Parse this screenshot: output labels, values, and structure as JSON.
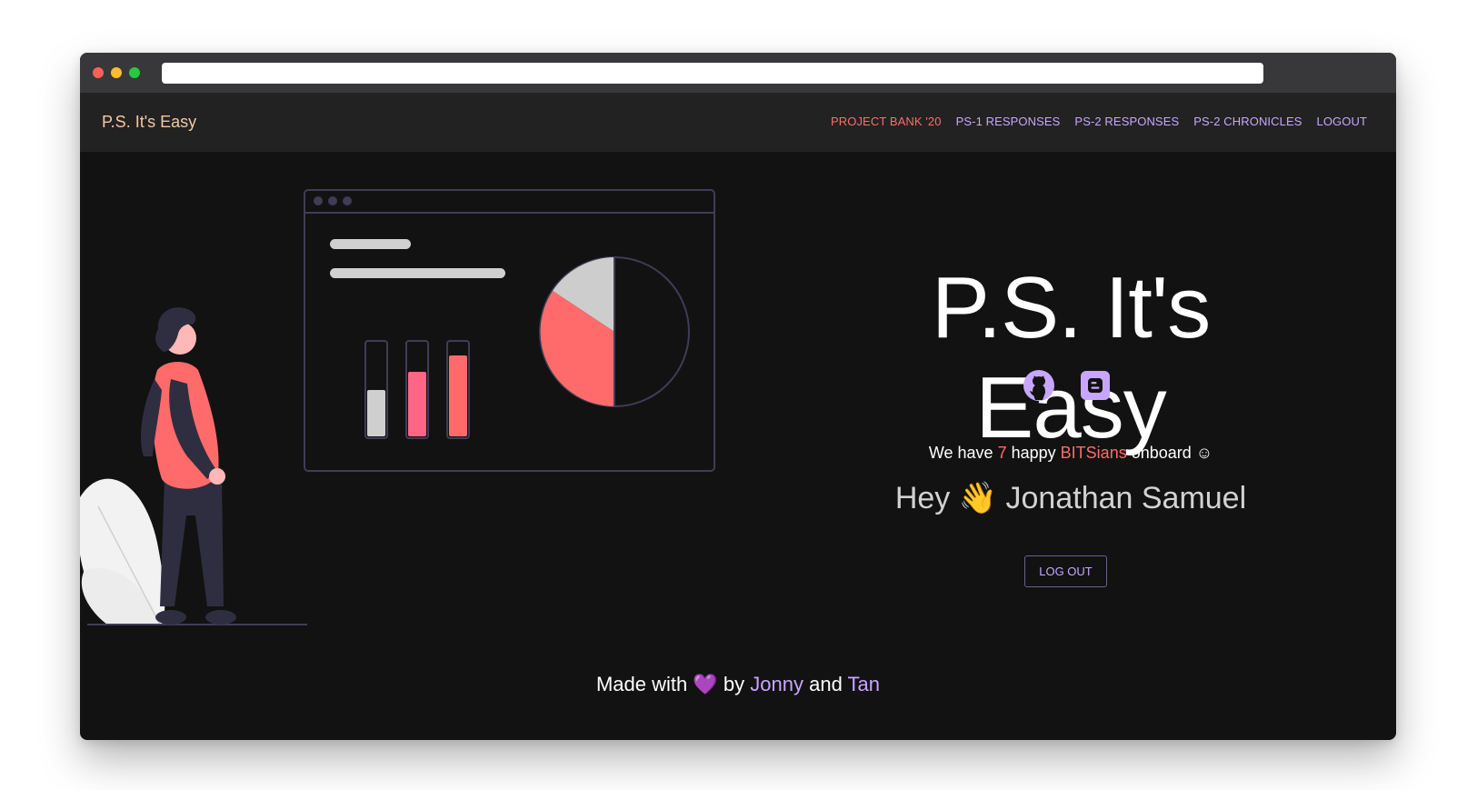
{
  "browser": {
    "url": ""
  },
  "navbar": {
    "brand": "P.S. It's Easy",
    "links": [
      {
        "label": "PROJECT BANK '20",
        "color": "#ff6b6b"
      },
      {
        "label": "PS-1 RESPONSES",
        "color": "#c8a6ff"
      },
      {
        "label": "PS-2 RESPONSES",
        "color": "#c8a6ff"
      },
      {
        "label": "PS-2 CHRONICLES",
        "color": "#c8a6ff"
      },
      {
        "label": "LOGOUT",
        "color": "#c8a6ff"
      }
    ]
  },
  "hero": {
    "title": "P.S. It's Easy",
    "icons": [
      "github-icon",
      "blogger-icon"
    ],
    "count_prefix": "We have",
    "count_value": "7",
    "count_middle": "happy",
    "count_highlight": "BITSians",
    "count_suffix": "onboard ☺",
    "greeting": "Hey 👋 Jonathan Samuel",
    "logout_button": "LOG OUT"
  },
  "footer": {
    "prefix": "Made with",
    "heart": "💜",
    "by": "by",
    "author1": "Jonny",
    "and": "and",
    "author2": "Tan"
  },
  "colors": {
    "accent_purple": "#c8a6ff",
    "accent_red": "#ff6b6b",
    "background": "#121212",
    "navbar": "#222222"
  }
}
